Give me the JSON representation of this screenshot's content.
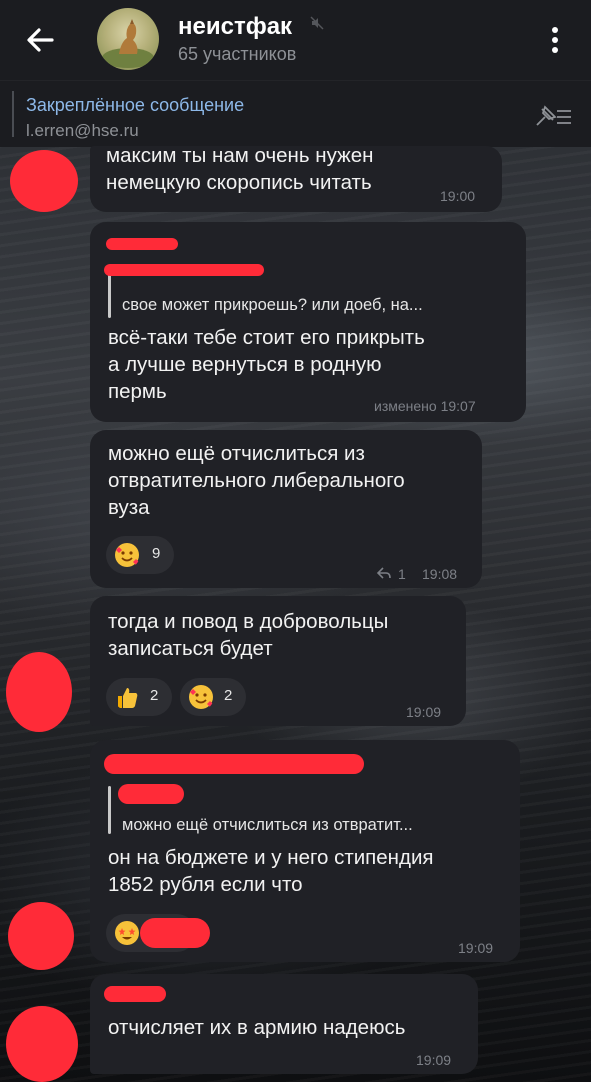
{
  "header": {
    "title": "неистфак",
    "subtitle": "65 участников"
  },
  "pinned": {
    "title": "Закреплённое сообщение",
    "text": "l.erren@hse.ru"
  },
  "messages": [
    {
      "text": "максим ты нам очень нужен\nнемецкую скоропись читать",
      "time": "19:00"
    },
    {
      "quote": "свое может прикроешь? или доеб, на...",
      "text": "всё-таки тебе стоит его прикрыть\nа лучше вернуться в родную\nпермь",
      "time": "изменено 19:07"
    },
    {
      "text": "можно ещё отчислиться из\nотвратительного либерального\nвуза",
      "reaction_count": "9",
      "replies": "1",
      "time": "19:08"
    },
    {
      "text": "тогда и повод в добровольцы\nзаписаться будет",
      "reactions": [
        "2",
        "2"
      ],
      "time": "19:09"
    },
    {
      "quote": "можно ещё отчислиться из отвратит...",
      "text": "он на бюджете и у него стипендия\n1852 рубля если что",
      "time": "19:09"
    },
    {
      "text": "отчисляет их в армию надеюсь",
      "time": "19:09"
    }
  ],
  "icons": {
    "back": "arrow-left-icon",
    "menu": "vertical-dots-icon",
    "mute": "mute-icon",
    "pin_list": "pin-list-icon",
    "reply": "reply-arrow-icon",
    "thumbs_up": "thumbs-up-icon",
    "smiley_hearts": "smiling-face-with-hearts-icon",
    "star_struck": "star-struck-icon"
  },
  "colors": {
    "accent": "#8db8e8",
    "bubble": "#202126",
    "redaction": "#ff2b38"
  }
}
